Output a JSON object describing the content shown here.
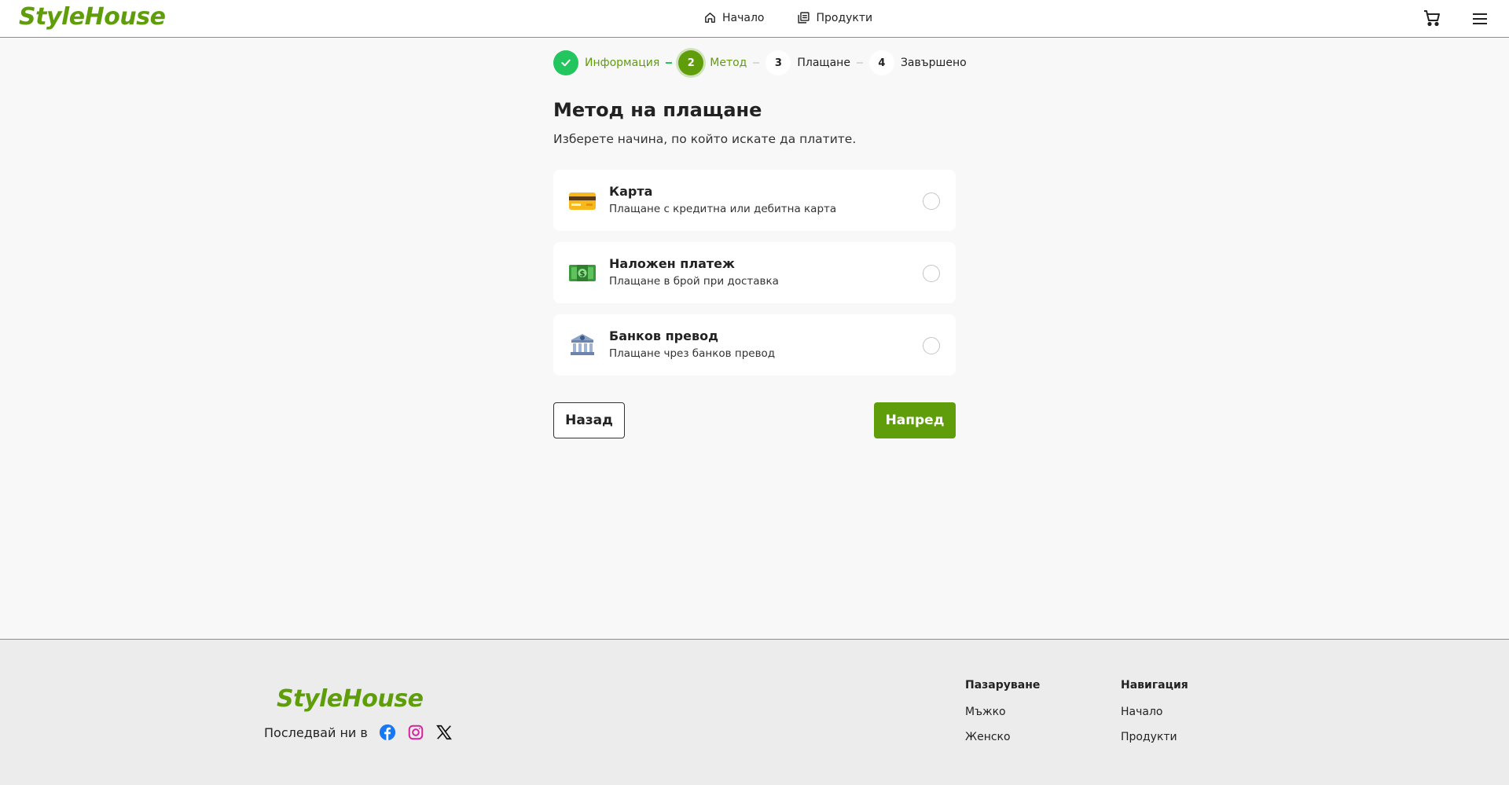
{
  "header": {
    "logo": "StyleHouse",
    "nav": [
      {
        "label": "Начало",
        "icon": "home-icon"
      },
      {
        "label": "Продукти",
        "icon": "products-icon"
      }
    ],
    "cart_icon": "cart-icon",
    "menu_icon": "hamburger-menu-icon"
  },
  "stepper": {
    "steps": [
      {
        "number": "✓",
        "label": "Информация",
        "state": "done"
      },
      {
        "number": "2",
        "label": "Метод",
        "state": "active"
      },
      {
        "number": "3",
        "label": "Плащане",
        "state": "todo"
      },
      {
        "number": "4",
        "label": "Завършено",
        "state": "todo"
      }
    ]
  },
  "main": {
    "title": "Метод на плащане",
    "subtitle": "Изберете начина, по който искате да платите.",
    "options": [
      {
        "title": "Карта",
        "description": "Плащане с кредитна или дебитна карта",
        "icon": "credit-card-icon",
        "selected": false
      },
      {
        "title": "Наложен платеж",
        "description": "Плащане в брой при доставка",
        "icon": "cash-icon",
        "selected": false
      },
      {
        "title": "Банков превод",
        "description": "Плащане чрез банков превод",
        "icon": "bank-icon",
        "selected": false
      }
    ],
    "back_label": "Назад",
    "next_label": "Напред"
  },
  "footer": {
    "logo": "StyleHouse",
    "follow_text": "Последвай ни в",
    "social": [
      "facebook-icon",
      "instagram-icon",
      "x-icon"
    ],
    "columns": [
      {
        "title": "Пазаруване",
        "links": [
          "Мъжко",
          "Женско"
        ]
      },
      {
        "title": "Навигация",
        "links": [
          "Начало",
          "Продукти"
        ]
      }
    ]
  },
  "colors": {
    "brand": "#5f9e0a",
    "step_done": "#22c55e",
    "background": "#f8f8f8",
    "footer_background": "#ececec"
  }
}
